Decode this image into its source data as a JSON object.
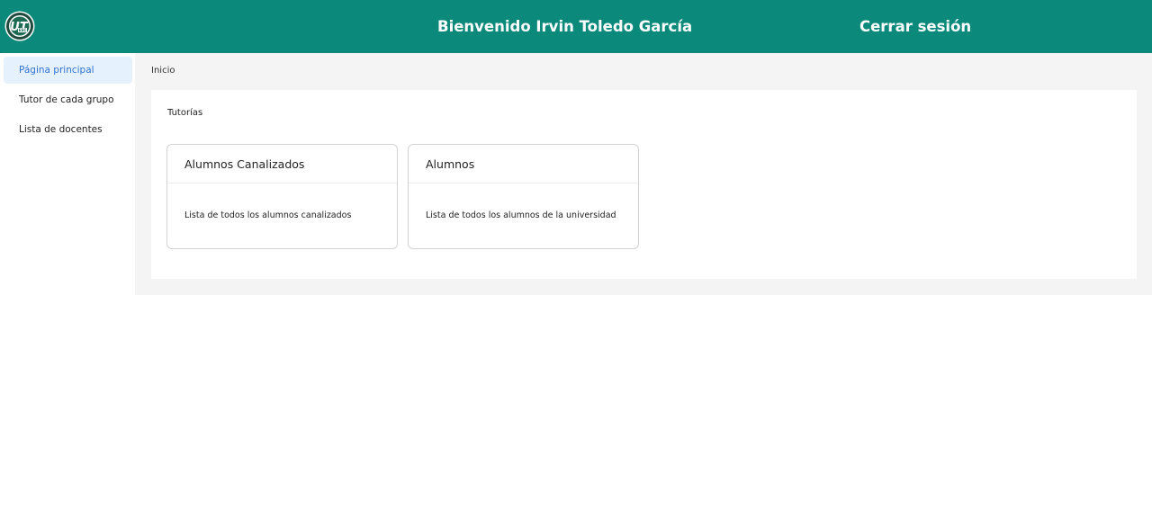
{
  "header": {
    "logo_icon": "ut-university-seal-icon",
    "welcome_text": "Bienvenido Irvin Toledo García",
    "logout_label": "Cerrar sesión",
    "background_color": "#0b8a7b"
  },
  "sidebar": {
    "items": [
      {
        "label": "Página principal",
        "active": true
      },
      {
        "label": "Tutor de cada grupo",
        "active": false
      },
      {
        "label": "Lista de docentes",
        "active": false
      }
    ]
  },
  "main": {
    "breadcrumb": "Inicio",
    "section_title": "Tutorías",
    "cards": [
      {
        "title": "Alumnos Canalizados",
        "description": "Lista de todos los alumnos canalizados"
      },
      {
        "title": "Alumnos",
        "description": "Lista de todos los alumnos de la universidad"
      }
    ]
  }
}
